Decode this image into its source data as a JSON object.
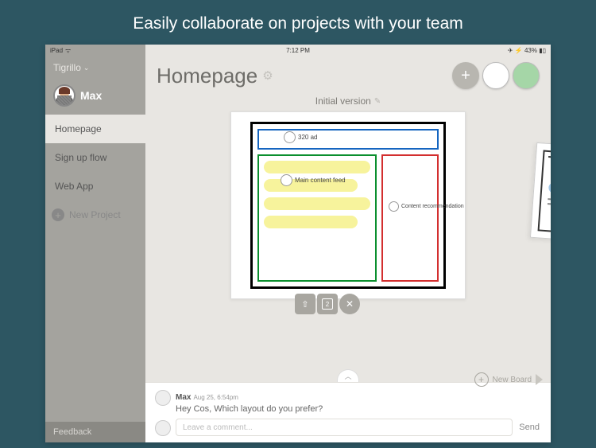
{
  "promo": "Easily collaborate on projects with your team",
  "status": {
    "device": "iPad",
    "time": "7:12 PM",
    "battery": "43%"
  },
  "workspace": "Tigrillo",
  "user": "Max",
  "nav": [
    {
      "label": "Homepage",
      "active": true
    },
    {
      "label": "Sign up flow",
      "active": false
    },
    {
      "label": "Web App",
      "active": false
    }
  ],
  "new_project": "New Project",
  "feedback": "Feedback",
  "page_title": "Homepage",
  "version": "Initial version",
  "annotations": {
    "ad": "320 ad",
    "main": "Main content feed",
    "rec": "Content recommendation"
  },
  "toolbar_count": "2",
  "new_board": "New Board",
  "comment": {
    "author": "Max",
    "time": "Aug 25, 6:54pm",
    "text": "Hey Cos, Which layout do you prefer?"
  },
  "compose_placeholder": "Leave a comment...",
  "send": "Send"
}
